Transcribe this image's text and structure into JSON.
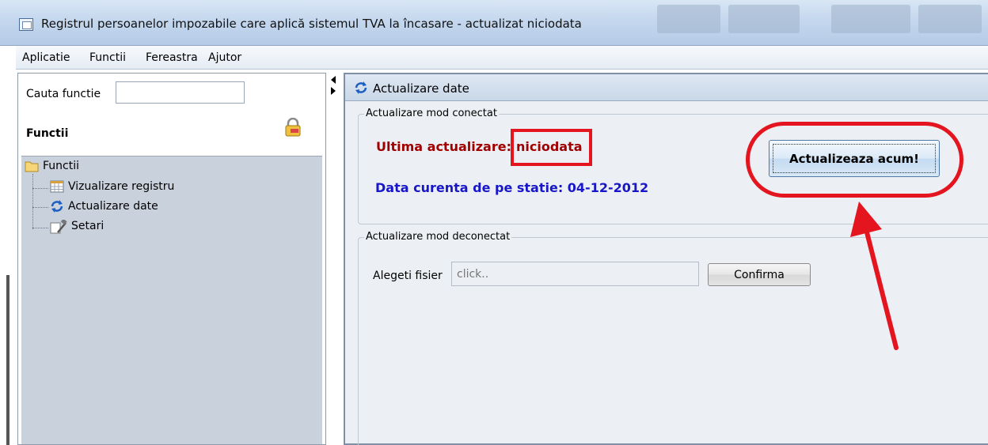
{
  "window": {
    "title": "Registrul persoanelor impozabile care aplică sistemul  TVA la încasare - actualizat niciodata"
  },
  "menu": {
    "items": [
      "Aplicatie",
      "Functii",
      "Fereastra",
      "Ajutor"
    ]
  },
  "sidebar": {
    "search_label": "Cauta functie",
    "search_value": "",
    "heading": "Functii",
    "tree": {
      "root": "Functii",
      "children": [
        "Vizualizare registru",
        "Actualizare date",
        "Setari"
      ]
    }
  },
  "frame": {
    "title": "Actualizare date",
    "connected": {
      "legend": "Actualizare mod conectat",
      "last_update_label": "Ultima actualizare:",
      "last_update_value": "niciodata",
      "current_date": "Data curenta de pe statie: 04-12-2012",
      "update_button": "Actualizeaza acum!"
    },
    "disconnected": {
      "legend": "Actualizare mod deconectat",
      "file_label": "Alegeti fisier",
      "file_placeholder": "click..",
      "confirm_button": "Confirma"
    }
  },
  "colors": {
    "annotation_red": "#e4151f",
    "last_update_text": "#a00000",
    "current_date_text": "#1717c9",
    "tree_background": "#c8d1dc"
  },
  "icons": {
    "app": "app-window-icon",
    "lock": "lock-icon",
    "folder": "folder-icon",
    "table": "table-icon",
    "refresh": "refresh-icon",
    "tools": "tools-icon"
  }
}
